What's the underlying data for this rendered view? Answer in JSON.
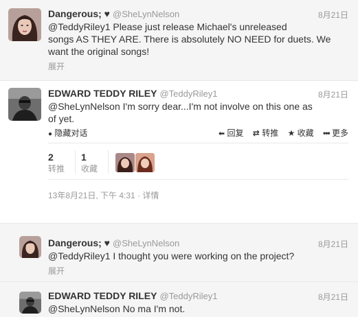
{
  "tweets": [
    {
      "name": "Dangerous; ♥",
      "handle": "@SheLynNelson",
      "time": "8月21日",
      "line1": "@TeddyRiley1 Please just release Michael's unreleased",
      "line2": "songs AS THEY ARE. There is absolutely NO NEED for duets. We",
      "line3": "want the original songs!",
      "expand": "展开"
    },
    {
      "name": "EDWARD TEDDY RILEY",
      "handle": "@TeddyRiley1",
      "time": "8月21日",
      "line1": "@SheLynNelson I'm sorry dear...I'm not involve on this one as",
      "line2": "of yet.",
      "hide_conversation": "隐藏对话",
      "actions": {
        "reply": "回复",
        "retweet": "转推",
        "favorite": "收藏",
        "more": "更多"
      },
      "stats": {
        "retweets": "2",
        "retweets_label": "转推",
        "favorites": "1",
        "favorites_label": "收藏"
      },
      "full_time": "13年8月21日, 下午 4:31 · 详情"
    },
    {
      "name": "Dangerous; ♥",
      "handle": "@SheLynNelson",
      "time": "8月21日",
      "line1": "@TeddyRiley1 I thought you were working on the project?",
      "expand": "展开"
    },
    {
      "name": "EDWARD TEDDY RILEY",
      "handle": "@TeddyRiley1",
      "time": "8月21日",
      "line1": "@SheLynNelson No ma I'm not."
    }
  ],
  "icons": {
    "hide": "●",
    "reply": "⬅",
    "retweet": "⇄",
    "favorite": "★",
    "more": "•••"
  }
}
